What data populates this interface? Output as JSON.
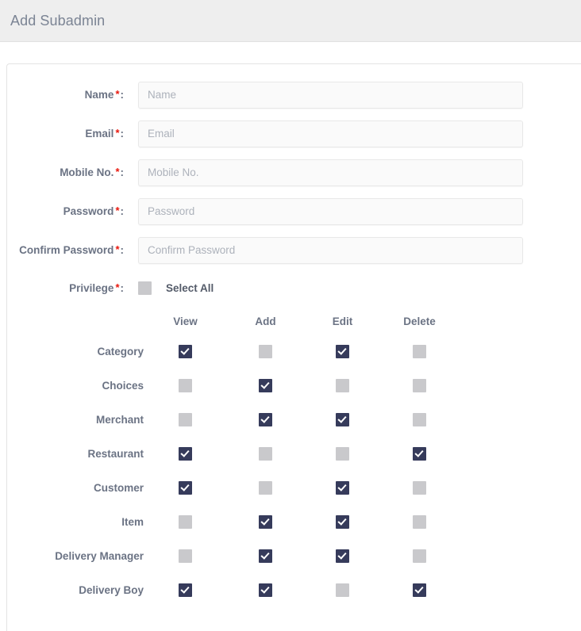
{
  "header": {
    "title": "Add Subadmin"
  },
  "form": {
    "fields": [
      {
        "label": "Name",
        "required": true,
        "value": "",
        "placeholder": "Name",
        "name": "name-field"
      },
      {
        "label": "Email",
        "required": true,
        "value": "",
        "placeholder": "Email",
        "name": "email-field"
      },
      {
        "label": "Mobile No.",
        "required": true,
        "value": "",
        "placeholder": "Mobile No.",
        "name": "mobile-field"
      },
      {
        "label": "Password",
        "required": true,
        "value": "",
        "placeholder": "Password",
        "name": "password-field"
      },
      {
        "label": "Confirm Password",
        "required": true,
        "value": "",
        "placeholder": "Confirm Password",
        "name": "confirm-password-field"
      }
    ],
    "privilege": {
      "label": "Privilege",
      "required": true,
      "select_all_label": "Select All",
      "select_all_checked": false
    }
  },
  "permissions": {
    "columns": [
      "View",
      "Add",
      "Edit",
      "Delete"
    ],
    "rows": [
      {
        "name": "Category",
        "values": [
          true,
          false,
          true,
          false
        ]
      },
      {
        "name": "Choices",
        "values": [
          false,
          true,
          false,
          false
        ]
      },
      {
        "name": "Merchant",
        "values": [
          false,
          true,
          true,
          false
        ]
      },
      {
        "name": "Restaurant",
        "values": [
          true,
          false,
          false,
          true
        ]
      },
      {
        "name": "Customer",
        "values": [
          true,
          false,
          true,
          false
        ]
      },
      {
        "name": "Item",
        "values": [
          false,
          true,
          true,
          false
        ]
      },
      {
        "name": "Delivery Manager",
        "values": [
          false,
          true,
          true,
          false
        ]
      },
      {
        "name": "Delivery Boy",
        "values": [
          true,
          true,
          false,
          true
        ]
      }
    ]
  },
  "colors": {
    "checked": "#363b5b",
    "unchecked": "#c9c9cc",
    "required_asterisk": "#e8160c",
    "label_text": "#6b7384",
    "header_bg": "#eeeeee"
  },
  "symbols": {
    "asterisk": "*",
    "colon": ":"
  }
}
